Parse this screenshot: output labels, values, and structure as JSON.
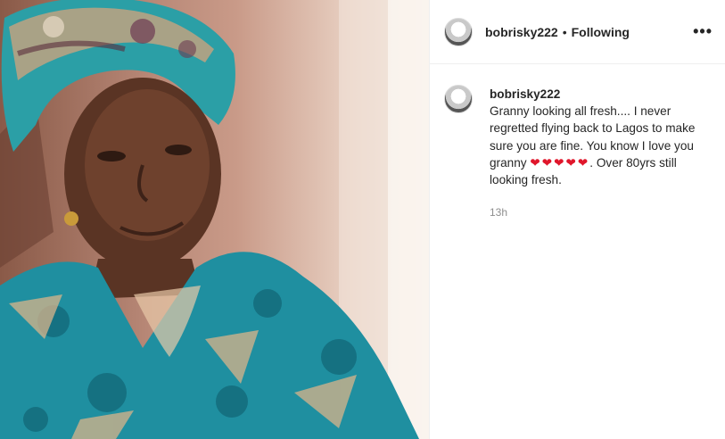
{
  "post": {
    "photo_alt": "Granny photo",
    "author": {
      "username": "bobrisky222",
      "separator": "•",
      "follow_status": "Following",
      "avatar_icon": "user-avatar"
    },
    "more_icon": "•••",
    "caption": {
      "username": "bobrisky222",
      "text_before": "Granny looking all fresh.... I never regretted flying back to Lagos to make sure you are fine. You know I love you granny ",
      "hearts": "❤❤❤❤❤",
      "text_after": ". Over 80yrs still looking fresh.",
      "timestamp": "13h"
    }
  }
}
